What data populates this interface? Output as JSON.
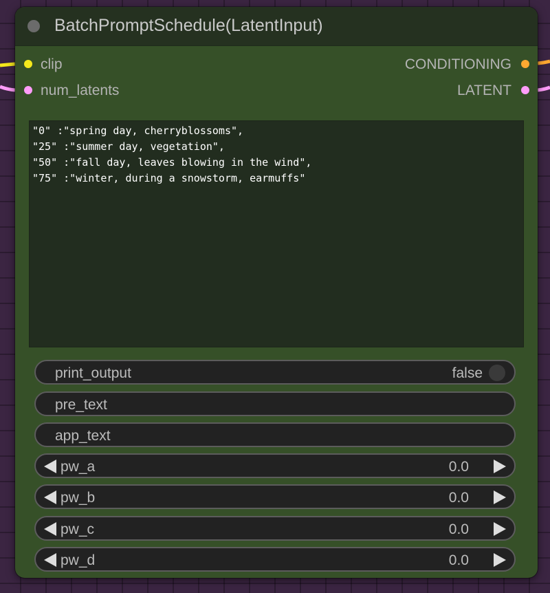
{
  "node": {
    "title": "BatchPromptSchedule(LatentInput)",
    "inputs": [
      {
        "label": "clip",
        "color": "#f5e81c"
      },
      {
        "label": "num_latents",
        "color": "#ff9cf9"
      }
    ],
    "outputs": [
      {
        "label": "CONDITIONING",
        "color": "#ffa931"
      },
      {
        "label": "LATENT",
        "color": "#ff9cf9"
      }
    ],
    "text": "\"0\" :\"spring day, cherryblossoms\",\n\"25\" :\"summer day, vegetation\",\n\"50\" :\"fall day, leaves blowing in the wind\",\n\"75\" :\"winter, during a snowstorm, earmuffs\"",
    "widgets": {
      "print_output": {
        "label": "print_output",
        "value": "false"
      },
      "pre_text": {
        "label": "pre_text"
      },
      "app_text": {
        "label": "app_text"
      },
      "pw_a": {
        "label": "pw_a",
        "value": "0.0"
      },
      "pw_b": {
        "label": "pw_b",
        "value": "0.0"
      },
      "pw_c": {
        "label": "pw_c",
        "value": "0.0"
      },
      "pw_d": {
        "label": "pw_d",
        "value": "0.0"
      }
    }
  },
  "wire_colors": {
    "clip": "#f5e81c",
    "conditioning": "#ffa931",
    "latent": "#ff9cf9"
  }
}
